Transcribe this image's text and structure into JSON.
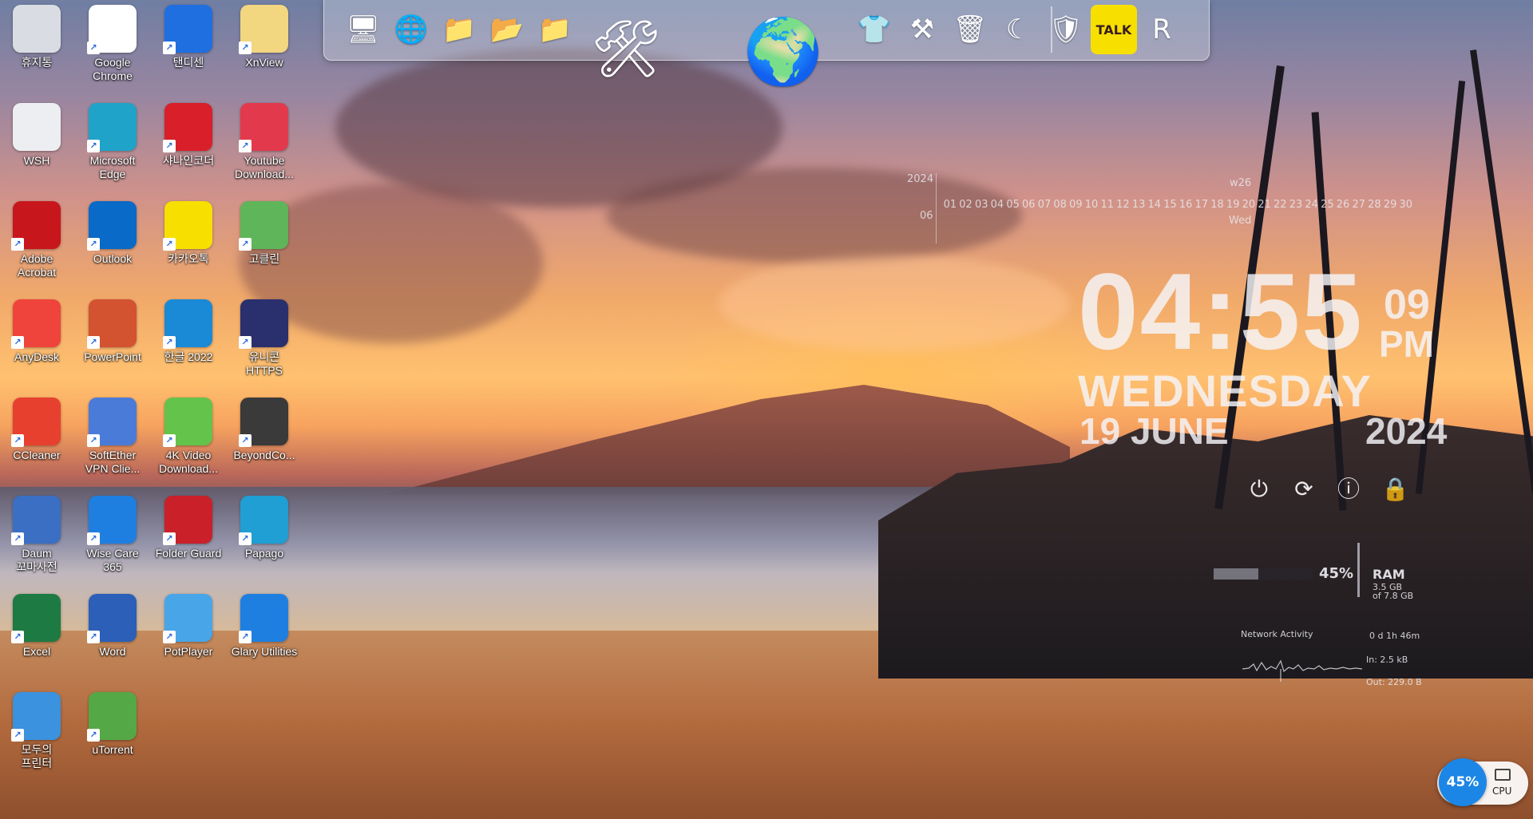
{
  "desktop": {
    "icons": [
      {
        "label": "휴지통",
        "icon": "recycle-bin-icon",
        "color": "#d9dde3"
      },
      {
        "label": "Google\nChrome",
        "icon": "chrome-icon",
        "color": "#ffffff"
      },
      {
        "label": "탠디센",
        "icon": "bolt-icon",
        "color": "#1f6fe0"
      },
      {
        "label": "XnView",
        "icon": "xnview-icon",
        "color": "#f2d680"
      },
      {
        "label": "WSH",
        "icon": "file-icon",
        "color": "#eceef2"
      },
      {
        "label": "Microsoft\nEdge",
        "icon": "edge-icon",
        "color": "#1fa3c9"
      },
      {
        "label": "샤나인코더",
        "icon": "shana-icon",
        "color": "#d81f2a"
      },
      {
        "label": "Youtube\nDownload...",
        "icon": "youtube-download-icon",
        "color": "#e23a4c"
      },
      {
        "label": "Adobe\nAcrobat",
        "icon": "acrobat-icon",
        "color": "#c8161d"
      },
      {
        "label": "Outlook",
        "icon": "outlook-icon",
        "color": "#0a6ac7"
      },
      {
        "label": "카카오톡",
        "icon": "kakaotalk-icon",
        "color": "#f7e000"
      },
      {
        "label": "고클린",
        "icon": "goclean-icon",
        "color": "#5fb55a"
      },
      {
        "label": "AnyDesk",
        "icon": "anydesk-icon",
        "color": "#ef443b"
      },
      {
        "label": "PowerPoint",
        "icon": "powerpoint-icon",
        "color": "#d35230"
      },
      {
        "label": "한글 2022",
        "icon": "hangul-icon",
        "color": "#1a8ad6"
      },
      {
        "label": "유니콘\nHTTPS",
        "icon": "https-icon",
        "color": "#2a2f6e"
      },
      {
        "label": "CCleaner",
        "icon": "ccleaner-icon",
        "color": "#e8402f"
      },
      {
        "label": "SoftEther\nVPN Clie...",
        "icon": "vpn-icon",
        "color": "#4a7bd8"
      },
      {
        "label": "4K Video\nDownload...",
        "icon": "4k-download-icon",
        "color": "#63c34a"
      },
      {
        "label": "BeyondCo...",
        "icon": "beyondcompare-icon",
        "color": "#3a3a3a"
      },
      {
        "label": "Daum\n꼬마사전",
        "icon": "dictionary-icon",
        "color": "#3a6fc4"
      },
      {
        "label": "Wise Care\n365",
        "icon": "wisecare-icon",
        "color": "#1f7fe0"
      },
      {
        "label": "Folder Guard",
        "icon": "folderguard-icon",
        "color": "#c9202a"
      },
      {
        "label": "Papago",
        "icon": "edge-icon",
        "color": "#1f9fd4"
      },
      {
        "label": "Excel",
        "icon": "excel-icon",
        "color": "#1d7a43"
      },
      {
        "label": "Word",
        "icon": "word-icon",
        "color": "#2b5fb8"
      },
      {
        "label": "PotPlayer",
        "icon": "play-icon",
        "color": "#48a6e8"
      },
      {
        "label": "Glary Utilities",
        "icon": "glary-icon",
        "color": "#1f7fe0"
      },
      {
        "label": "모두의\n프린터",
        "icon": "printer-icon",
        "color": "#3b92de"
      },
      {
        "label": "uTorrent",
        "icon": "utorrent-icon",
        "color": "#55a846"
      }
    ]
  },
  "dock": {
    "items": [
      {
        "name": "computer-icon",
        "glyph": "🖥"
      },
      {
        "name": "network-globe-icon",
        "glyph": "🌐"
      },
      {
        "name": "folder-icon",
        "glyph": "📁"
      },
      {
        "name": "green-folder-icon",
        "glyph": "📂"
      },
      {
        "name": "blue-folder-icon",
        "glyph": "📁"
      },
      {
        "name": "tools-icon",
        "glyph": "🛠"
      },
      {
        "name": "globe-icon",
        "glyph": "🌍"
      },
      {
        "name": "tshirt-icon",
        "glyph": "👕"
      },
      {
        "name": "hammer-icon",
        "glyph": "⚒"
      },
      {
        "name": "trash-icon",
        "glyph": "🗑"
      },
      {
        "name": "glary-moon-icon",
        "glyph": "☾"
      },
      {
        "name": "wisecare-shield-icon",
        "glyph": "🛡"
      },
      {
        "name": "kakaotalk-icon",
        "glyph": "TALK"
      },
      {
        "name": "registry-icon",
        "glyph": "R"
      }
    ]
  },
  "calendar": {
    "year": "2024",
    "month": "06",
    "week": "w26",
    "day_of_week": "Wed",
    "days": [
      "01",
      "02",
      "03",
      "04",
      "05",
      "06",
      "07",
      "08",
      "09",
      "10",
      "11",
      "12",
      "13",
      "14",
      "15",
      "16",
      "17",
      "18",
      "19",
      "20",
      "21",
      "22",
      "23",
      "24",
      "25",
      "26",
      "27",
      "28",
      "29",
      "30"
    ]
  },
  "clock": {
    "time": "04:55",
    "seconds": "09",
    "ampm": "PM",
    "weekday": "WEDNESDAY",
    "date": "19 JUNE",
    "year": "2024"
  },
  "power": {
    "buttons": [
      {
        "name": "shutdown-icon",
        "glyph": "⏻"
      },
      {
        "name": "restart-icon",
        "glyph": "⟳"
      },
      {
        "name": "sleep-icon",
        "glyph": "ⓘ"
      },
      {
        "name": "lock-icon",
        "glyph": "🔒"
      }
    ]
  },
  "ram": {
    "percent_label": "45%",
    "percent": 0.45,
    "title": "RAM",
    "used": "3.5 GB",
    "total": "of 7.8 GB"
  },
  "network": {
    "title": "Network Activity",
    "uptime": "0 d 1h 46m",
    "in": "In: 2.5 kB",
    "out": "Out: 229.0 B"
  },
  "cpu": {
    "percent_label": "45%",
    "label": "CPU"
  }
}
